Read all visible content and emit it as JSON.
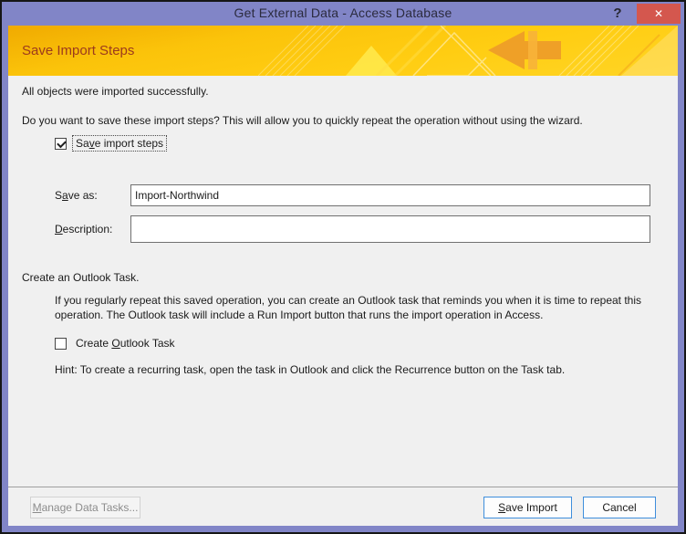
{
  "colors": {
    "titlebar_purple": "#8185C7",
    "close_button_red": "#D4574E",
    "banner_gold": "#FBC30A",
    "banner_title_red": "#9C3A1D",
    "body_background": "#F0F0F0",
    "accent_button_border": "#3E8EDC"
  },
  "titlebar": {
    "title": "Get External Data - Access Database",
    "help_icon": "?",
    "close_icon": "✕"
  },
  "banner": {
    "title": "Save Import Steps"
  },
  "body": {
    "status_text": "All objects were imported successfully.",
    "question_text": "Do you want to save these import steps? This will allow you to quickly repeat the operation without using the wizard.",
    "save_steps_checkbox": {
      "checked": true,
      "label_pre": "Sa",
      "label_accel": "v",
      "label_post": "e import steps"
    },
    "save_as_field": {
      "label_pre": "S",
      "label_accel": "a",
      "label_post": "ve as:",
      "value": "Import-Northwind"
    },
    "description_field": {
      "label_pre": "",
      "label_accel": "D",
      "label_post": "escription:",
      "value": ""
    },
    "outlook_heading": "Create an Outlook Task.",
    "outlook_paragraph": "If you regularly repeat this saved operation, you can create an Outlook task that reminds you when it is time to repeat this operation. The Outlook task will include a Run Import button that runs the import operation in Access.",
    "outlook_checkbox": {
      "checked": false,
      "label_pre": "Create ",
      "label_accel": "O",
      "label_post": "utlook Task"
    },
    "hint_text": "Hint: To create a recurring task, open the task in Outlook and click the Recurrence button on the Task tab."
  },
  "footer": {
    "manage_button": {
      "label_pre": "",
      "label_accel": "M",
      "label_post": "anage Data Tasks...",
      "enabled": false
    },
    "save_import_button": {
      "label_pre": "",
      "label_accel": "S",
      "label_post": "ave Import"
    },
    "cancel_button": {
      "label": "Cancel"
    }
  }
}
